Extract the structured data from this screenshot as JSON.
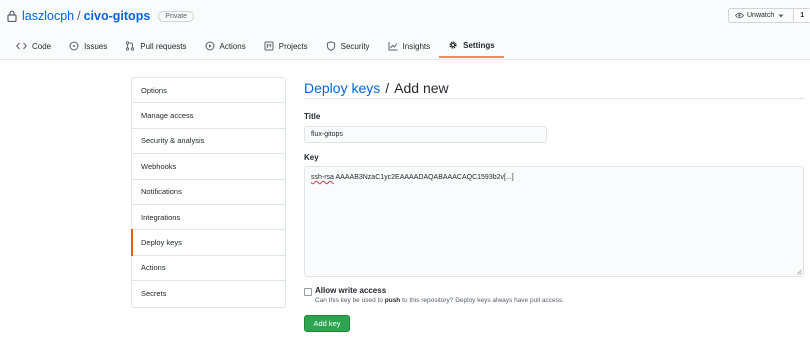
{
  "repo": {
    "owner": "laszlocph",
    "separator": "/",
    "name": "civo-gitops",
    "visibility": "Private"
  },
  "watch": {
    "label": "Unwatch",
    "count": "1"
  },
  "tabs": [
    {
      "label": "Code",
      "icon": "code-icon"
    },
    {
      "label": "Issues",
      "icon": "issue-icon"
    },
    {
      "label": "Pull requests",
      "icon": "pull-request-icon"
    },
    {
      "label": "Actions",
      "icon": "play-icon"
    },
    {
      "label": "Projects",
      "icon": "project-icon"
    },
    {
      "label": "Security",
      "icon": "shield-icon"
    },
    {
      "label": "Insights",
      "icon": "graph-icon"
    },
    {
      "label": "Settings",
      "icon": "gear-icon",
      "active": true
    }
  ],
  "sidebar": {
    "items": [
      {
        "label": "Options"
      },
      {
        "label": "Manage access"
      },
      {
        "label": "Security & analysis"
      },
      {
        "label": "Webhooks"
      },
      {
        "label": "Notifications"
      },
      {
        "label": "Integrations"
      },
      {
        "label": "Deploy keys",
        "active": true
      },
      {
        "label": "Actions"
      },
      {
        "label": "Secrets"
      }
    ]
  },
  "main": {
    "breadcrumb": "Deploy keys",
    "breadcrumb_sep": "/",
    "title": "Add new",
    "title_label": "Title",
    "title_value": "flux-gitops",
    "key_label": "Key",
    "key_prefix": "ssh-rsa",
    "key_rest": " AAAAB3NzaC1yc2EAAAADAQABAAACAQC1593b2v[...]",
    "write_access_label": "Allow write access",
    "write_access_note_pre": "Can this key be used to ",
    "write_access_note_bold": "push",
    "write_access_note_post": " to this repository? Deploy keys always have pull access.",
    "add_button": "Add key"
  },
  "colors": {
    "link": "#0366d6",
    "primary_button": "#2ea44f",
    "active_tab_underline": "#f9826c",
    "sidebar_active": "#e36209"
  }
}
